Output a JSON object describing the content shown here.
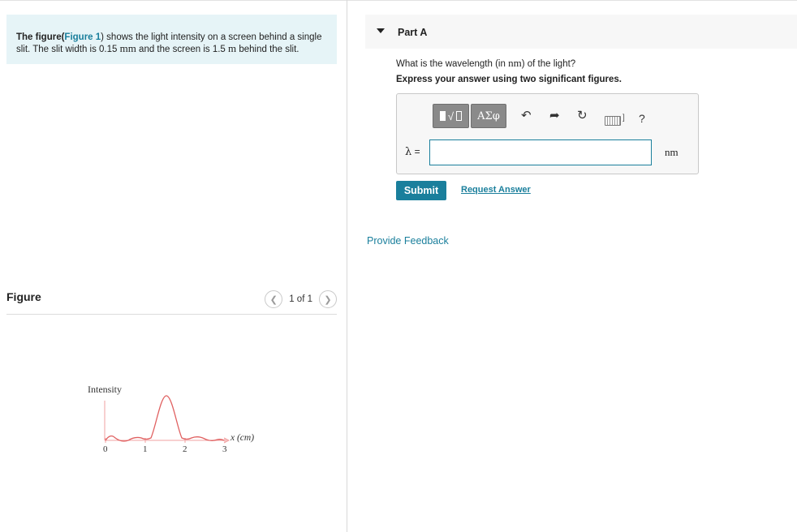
{
  "intro": {
    "prefix": "The figure(",
    "figure_link": "Figure 1",
    "text1": ") shows the light intensity on a screen behind a single slit. The slit width is 0.15 ",
    "unit_mm": "mm",
    "text2": " and the screen is 1.5 ",
    "unit_m": "m",
    "text3": " behind the slit."
  },
  "figure_panel": {
    "title": "Figure",
    "pager_text": "1 of 1",
    "prev_icon": "chevron-left-icon",
    "next_icon": "chevron-right-icon"
  },
  "plot": {
    "ylabel": "Intensity",
    "xlabel": "x (cm)",
    "ticks": [
      "0",
      "1",
      "2",
      "3"
    ],
    "axis_color": "#f0a0a0",
    "curve_color": "#e06060"
  },
  "part": {
    "title": "Part A",
    "question_prefix": "What is the wavelength (in ",
    "question_unit": "nm",
    "question_suffix": ") of the light?",
    "instruction": "Express your answer using two significant figures."
  },
  "toolbar": {
    "greek_label": "ΑΣφ",
    "undo_icon": "undo-icon",
    "redo_icon": "redo-icon",
    "reset_icon": "reset-icon",
    "keyboard_icon": "keyboard-icon",
    "help_label": "?"
  },
  "answer": {
    "variable": "λ",
    "equals": " =",
    "value": "",
    "unit": "nm"
  },
  "actions": {
    "submit_label": "Submit",
    "request_label": "Request Answer",
    "feedback_label": "Provide Feedback"
  },
  "colors": {
    "accent": "#1a7f9c",
    "intro_bg": "#e6f4f7",
    "toolbar_button": "#8a8a8a"
  }
}
